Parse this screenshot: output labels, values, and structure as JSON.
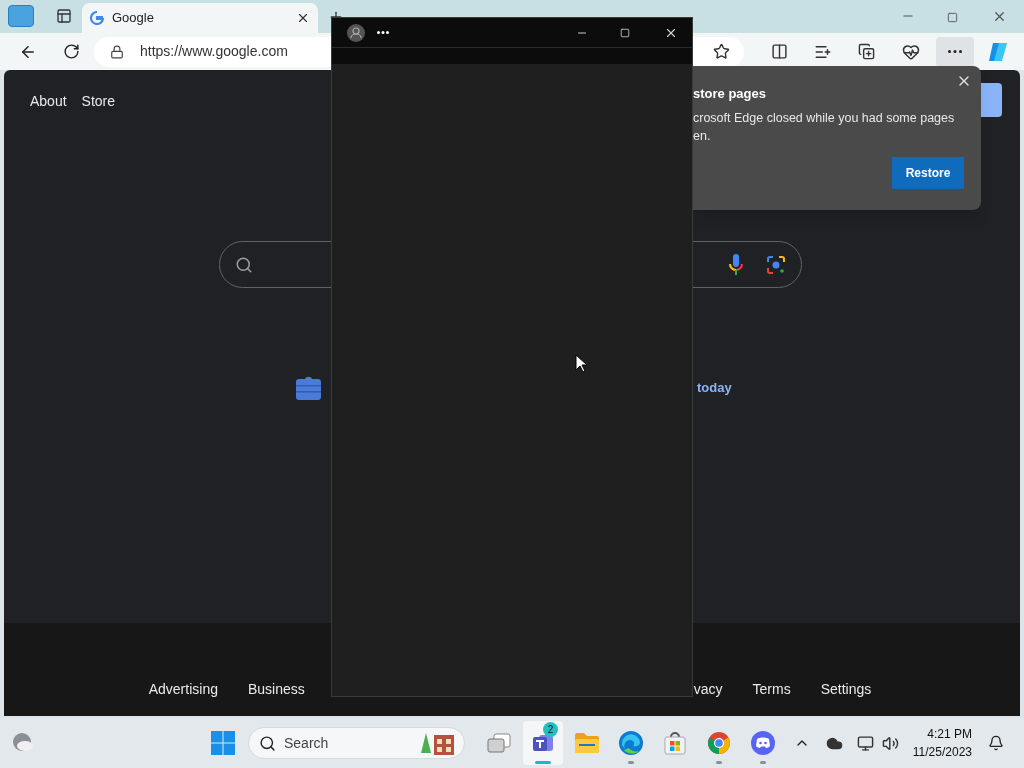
{
  "browser": {
    "tabs": [
      {
        "title": "Google",
        "selected": true
      }
    ],
    "address": "https://www.google.com"
  },
  "page": {
    "nav_links": [
      "About",
      "Store"
    ],
    "promo_link": "today",
    "footer_links": [
      "Advertising",
      "Business",
      "vacy",
      "Terms",
      "Settings"
    ]
  },
  "restore_popup": {
    "title": "store pages",
    "message_lines": [
      "crosoft Edge closed while you had some pages",
      "en."
    ],
    "button": "Restore"
  },
  "taskbar": {
    "search_placeholder": "Search",
    "apps": [
      {
        "kind": "taskview",
        "selected": false,
        "running": false
      },
      {
        "kind": "teams",
        "badge": "2",
        "selected": true,
        "running": true
      },
      {
        "kind": "explorer",
        "selected": false,
        "running": false
      },
      {
        "kind": "edge",
        "selected": false,
        "running": true
      },
      {
        "kind": "store",
        "selected": false,
        "running": false
      },
      {
        "kind": "chrome",
        "selected": false,
        "running": true
      },
      {
        "kind": "discord",
        "selected": false,
        "running": true
      }
    ],
    "time": "4:21 PM",
    "date": "11/25/2023"
  }
}
